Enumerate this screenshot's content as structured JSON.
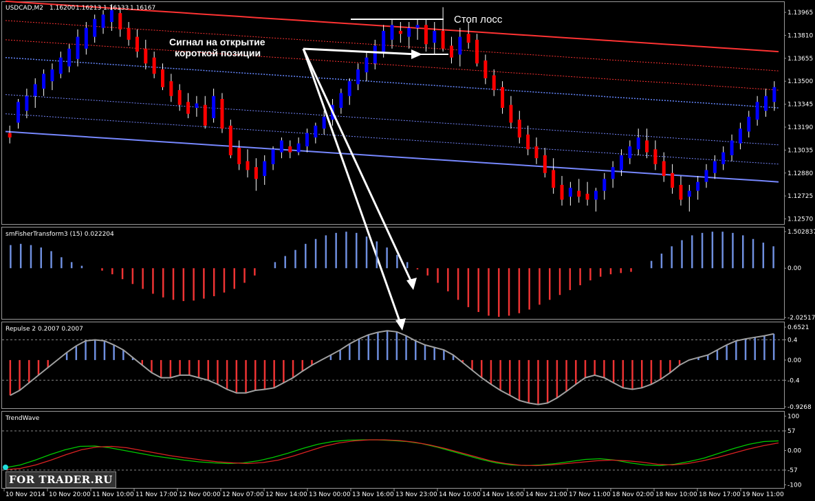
{
  "chart_data": [
    {
      "type": "candlestick",
      "title": "USDCAD,M2",
      "header_values": [
        "1.16200",
        "1.16213",
        "1.16133",
        "1.16167"
      ],
      "yticks": [
        "1.13965",
        "1.13810",
        "1.13655",
        "1.13500",
        "1.13345",
        "1.13190",
        "1.13035",
        "1.12880",
        "1.12725",
        "1.12570"
      ],
      "ylim": [
        1.1254,
        1.1403
      ],
      "colors": {
        "bull": "#0000ff",
        "bear": "#ff0000",
        "wick": "#ffffff",
        "bands_upper": "#ff3333",
        "bands_mid": "#6688ff",
        "bands_lower": "#7788ff"
      },
      "candles": [
        [
          1.1315,
          1.132,
          1.1308,
          1.1312
        ],
        [
          1.1322,
          1.1338,
          1.1318,
          1.1336
        ],
        [
          1.133,
          1.1345,
          1.1325,
          1.134
        ],
        [
          1.134,
          1.1352,
          1.1332,
          1.1348
        ],
        [
          1.1345,
          1.1358,
          1.134,
          1.1355
        ],
        [
          1.135,
          1.1362,
          1.1344,
          1.1358
        ],
        [
          1.1355,
          1.137,
          1.1352,
          1.1366
        ],
        [
          1.136,
          1.1375,
          1.1356,
          1.1372
        ],
        [
          1.1365,
          1.1385,
          1.136,
          1.138
        ],
        [
          1.1372,
          1.139,
          1.1368,
          1.1386
        ],
        [
          1.138,
          1.1395,
          1.1376,
          1.1392
        ],
        [
          1.1386,
          1.1398,
          1.1382,
          1.1395
        ],
        [
          1.139,
          1.1402,
          1.1384,
          1.1398
        ],
        [
          1.1396,
          1.14,
          1.138,
          1.1385
        ],
        [
          1.1386,
          1.139,
          1.1374,
          1.1378
        ],
        [
          1.138,
          1.1385,
          1.1366,
          1.137
        ],
        [
          1.1372,
          1.1378,
          1.1358,
          1.1362
        ],
        [
          1.1366,
          1.137,
          1.1352,
          1.1355
        ],
        [
          1.1358,
          1.1362,
          1.1344,
          1.1346
        ],
        [
          1.135,
          1.1355,
          1.1336,
          1.134
        ],
        [
          1.1344,
          1.1348,
          1.133,
          1.1334
        ],
        [
          1.1336,
          1.1342,
          1.1325,
          1.1328
        ],
        [
          1.1332,
          1.134,
          1.1326,
          1.1335
        ],
        [
          1.1334,
          1.134,
          1.1318,
          1.132
        ],
        [
          1.1325,
          1.1345,
          1.1322,
          1.134
        ],
        [
          1.1338,
          1.1342,
          1.1315,
          1.1318
        ],
        [
          1.132,
          1.1324,
          1.1298,
          1.13
        ],
        [
          1.1305,
          1.131,
          1.129,
          1.1294
        ],
        [
          1.1296,
          1.1304,
          1.1285,
          1.129
        ],
        [
          1.1292,
          1.1298,
          1.1276,
          1.1284
        ],
        [
          1.1286,
          1.13,
          1.128,
          1.1296
        ],
        [
          1.1294,
          1.1306,
          1.129,
          1.1304
        ],
        [
          1.1302,
          1.1312,
          1.1298,
          1.131
        ],
        [
          1.1306,
          1.131,
          1.1298,
          1.1302
        ],
        [
          1.1302,
          1.1312,
          1.13,
          1.1308
        ],
        [
          1.1306,
          1.1318,
          1.1302,
          1.1315
        ],
        [
          1.1312,
          1.1322,
          1.1308,
          1.132
        ],
        [
          1.1318,
          1.133,
          1.1314,
          1.1326
        ],
        [
          1.1324,
          1.1338,
          1.132,
          1.1334
        ],
        [
          1.1332,
          1.1345,
          1.1328,
          1.1342
        ],
        [
          1.134,
          1.1352,
          1.1334,
          1.135
        ],
        [
          1.1348,
          1.1362,
          1.1344,
          1.1358
        ],
        [
          1.1356,
          1.137,
          1.135,
          1.1366
        ],
        [
          1.1362,
          1.1378,
          1.1358,
          1.1374
        ],
        [
          1.137,
          1.1388,
          1.1366,
          1.1384
        ],
        [
          1.1378,
          1.1392,
          1.1372,
          1.1388
        ],
        [
          1.1384,
          1.139,
          1.1376,
          1.1382
        ],
        [
          1.138,
          1.139,
          1.1372,
          1.1386
        ],
        [
          1.1386,
          1.1392,
          1.1378,
          1.1388
        ],
        [
          1.1388,
          1.1392,
          1.137,
          1.1375
        ],
        [
          1.1376,
          1.139,
          1.1368,
          1.1384
        ],
        [
          1.1384,
          1.14,
          1.137,
          1.1372
        ],
        [
          1.1374,
          1.138,
          1.1362,
          1.1366
        ],
        [
          1.1368,
          1.1386,
          1.136,
          1.138
        ],
        [
          1.1382,
          1.139,
          1.1372,
          1.1376
        ],
        [
          1.1378,
          1.1382,
          1.136,
          1.1362
        ],
        [
          1.1364,
          1.1368,
          1.1348,
          1.1352
        ],
        [
          1.1354,
          1.1358,
          1.134,
          1.1344
        ],
        [
          1.1346,
          1.135,
          1.1328,
          1.1332
        ],
        [
          1.1334,
          1.134,
          1.1318,
          1.1322
        ],
        [
          1.1324,
          1.133,
          1.1308,
          1.1312
        ],
        [
          1.1314,
          1.132,
          1.13,
          1.1304
        ],
        [
          1.1306,
          1.1312,
          1.1294,
          1.1298
        ],
        [
          1.13,
          1.1305,
          1.1285,
          1.1288
        ],
        [
          1.129,
          1.1298,
          1.1274,
          1.1278
        ],
        [
          1.128,
          1.1286,
          1.1266,
          1.127
        ],
        [
          1.1272,
          1.1282,
          1.1266,
          1.1278
        ],
        [
          1.1276,
          1.1284,
          1.1268,
          1.1272
        ],
        [
          1.1274,
          1.1282,
          1.1266,
          1.127
        ],
        [
          1.127,
          1.1278,
          1.1262,
          1.1276
        ],
        [
          1.1276,
          1.1288,
          1.127,
          1.1284
        ],
        [
          1.1284,
          1.1296,
          1.1278,
          1.1292
        ],
        [
          1.129,
          1.1304,
          1.1286,
          1.13
        ],
        [
          1.1298,
          1.131,
          1.1294,
          1.1306
        ],
        [
          1.1304,
          1.1318,
          1.13,
          1.1312
        ],
        [
          1.131,
          1.1318,
          1.1298,
          1.1302
        ],
        [
          1.1304,
          1.131,
          1.129,
          1.1294
        ],
        [
          1.1296,
          1.1302,
          1.1282,
          1.1286
        ],
        [
          1.1288,
          1.1294,
          1.1274,
          1.1278
        ],
        [
          1.128,
          1.1286,
          1.1266,
          1.127
        ],
        [
          1.1272,
          1.128,
          1.1262,
          1.1276
        ],
        [
          1.1276,
          1.1286,
          1.127,
          1.1282
        ],
        [
          1.1282,
          1.1294,
          1.1278,
          1.129
        ],
        [
          1.1288,
          1.13,
          1.1284,
          1.1296
        ],
        [
          1.1294,
          1.1306,
          1.129,
          1.1302
        ],
        [
          1.13,
          1.1314,
          1.1296,
          1.131
        ],
        [
          1.1308,
          1.1322,
          1.1304,
          1.1318
        ],
        [
          1.1316,
          1.133,
          1.1312,
          1.1326
        ],
        [
          1.1324,
          1.134,
          1.132,
          1.1336
        ],
        [
          1.133,
          1.1345,
          1.1326,
          1.134
        ],
        [
          1.1336,
          1.135,
          1.133,
          1.1346
        ]
      ],
      "annotations": {
        "signal": "Сигнал на открытие короткой позиции",
        "signal_line1": "Сигнал на открытие",
        "signal_line2": "короткой позиции",
        "stop": "Стоп лосс"
      }
    },
    {
      "type": "bar",
      "title": "smFisherTransform3 (15) 0.022204",
      "yticks": [
        "1.502837",
        "0.00",
        "-2.02517"
      ],
      "ylim": [
        -2.02517,
        1.502837
      ],
      "colors": {
        "positive": "#6f8fdf",
        "negative": "#ee3333"
      },
      "values": [
        0.95,
        1.0,
        0.95,
        0.85,
        0.7,
        0.45,
        0.25,
        0.1,
        0,
        -0.1,
        -0.25,
        -0.45,
        -0.65,
        -0.85,
        -1.05,
        -1.2,
        -1.3,
        -1.35,
        -1.33,
        -1.25,
        -1.15,
        -1.0,
        -0.85,
        -0.6,
        -0.3,
        0,
        0.25,
        0.5,
        0.75,
        1.0,
        1.2,
        1.35,
        1.45,
        1.5,
        1.45,
        1.3,
        1.1,
        0.85,
        0.55,
        0.25,
        -0.05,
        -0.3,
        -0.6,
        -0.95,
        -1.3,
        -1.6,
        -1.8,
        -1.95,
        -2.0,
        -1.95,
        -1.85,
        -1.7,
        -1.5,
        -1.3,
        -1.1,
        -0.9,
        -0.7,
        -0.5,
        -0.35,
        -0.25,
        -0.2,
        -0.15,
        0,
        0.3,
        0.6,
        0.9,
        1.15,
        1.35,
        1.45,
        1.5,
        1.5,
        1.45,
        1.35,
        1.2,
        1.05,
        0.9
      ]
    },
    {
      "type": "bar",
      "title": "Repulse 2 0.2007 0.2007",
      "yticks": [
        "0.6521",
        "0.4",
        "0.00",
        "-0.4",
        "-0.9268"
      ],
      "ylim": [
        -0.9268,
        0.6521
      ],
      "levels": [
        0.4,
        -0.4
      ],
      "colors": {
        "positive": "#6f8fdf",
        "negative": "#ee3333",
        "line": "#a0a0a0"
      },
      "values": [
        -0.7,
        -0.6,
        -0.45,
        -0.3,
        -0.15,
        0.0,
        0.15,
        0.28,
        0.38,
        0.4,
        0.38,
        0.3,
        0.2,
        0.05,
        -0.1,
        -0.25,
        -0.35,
        -0.35,
        -0.3,
        -0.3,
        -0.35,
        -0.4,
        -0.48,
        -0.58,
        -0.65,
        -0.65,
        -0.6,
        -0.58,
        -0.55,
        -0.45,
        -0.35,
        -0.22,
        -0.1,
        0.0,
        0.1,
        0.2,
        0.32,
        0.42,
        0.5,
        0.55,
        0.58,
        0.56,
        0.48,
        0.38,
        0.3,
        0.25,
        0.2,
        0.1,
        -0.05,
        -0.2,
        -0.35,
        -0.48,
        -0.6,
        -0.7,
        -0.8,
        -0.85,
        -0.88,
        -0.85,
        -0.75,
        -0.62,
        -0.48,
        -0.35,
        -0.3,
        -0.35,
        -0.45,
        -0.55,
        -0.58,
        -0.55,
        -0.48,
        -0.38,
        -0.25,
        -0.1,
        0.0,
        0.05,
        0.1,
        0.2,
        0.3,
        0.38,
        0.42,
        0.45,
        0.48,
        0.52
      ]
    },
    {
      "type": "line",
      "title": "TrendWave",
      "yticks": [
        "100",
        "57",
        "0.00",
        "-57",
        "-100"
      ],
      "ylim": [
        -105,
        105
      ],
      "levels": [
        57,
        -57
      ],
      "series": [
        {
          "color": "#00cc00",
          "values": [
            -50,
            -42,
            -28,
            -12,
            2,
            12,
            13,
            8,
            0,
            -8,
            -16,
            -22,
            -28,
            -33,
            -36,
            -38,
            -36,
            -30,
            -20,
            -8,
            6,
            18,
            26,
            30,
            31,
            31,
            29,
            26,
            20,
            10,
            -2,
            -14,
            -26,
            -36,
            -42,
            -44,
            -42,
            -38,
            -32,
            -26,
            -24,
            -28,
            -36,
            -42,
            -44,
            -40,
            -32,
            -22,
            -8,
            6,
            18,
            26,
            28
          ]
        },
        {
          "color": "#dd2222",
          "values": [
            -56,
            -52,
            -42,
            -28,
            -12,
            2,
            10,
            12,
            8,
            0,
            -8,
            -16,
            -22,
            -28,
            -33,
            -36,
            -38,
            -35,
            -28,
            -16,
            -2,
            12,
            22,
            28,
            31,
            31,
            29,
            24,
            16,
            6,
            -6,
            -18,
            -30,
            -38,
            -43,
            -44,
            -42,
            -38,
            -34,
            -30,
            -28,
            -30,
            -34,
            -40,
            -42,
            -38,
            -30,
            -20,
            -8,
            4,
            14,
            22
          ]
        }
      ]
    }
  ],
  "x_axis": {
    "labels": [
      "10 Nov 2014",
      "10 Nov 20:00",
      "11 Nov 10:00",
      "11 Nov 17:00",
      "12 Nov 00:00",
      "12 Nov 07:00",
      "12 Nov 14:00",
      "13 Nov 00:00",
      "13 Nov 16:00",
      "13 Nov 23:00",
      "14 Nov 10:00",
      "14 Nov 16:00",
      "14 Nov 21:00",
      "17 Nov 11:00",
      "18 Nov 02:00",
      "18 Nov 10:00",
      "18 Nov 17:00",
      "19 Nov 11:00"
    ]
  },
  "logo": "FOR TRADER.RU"
}
